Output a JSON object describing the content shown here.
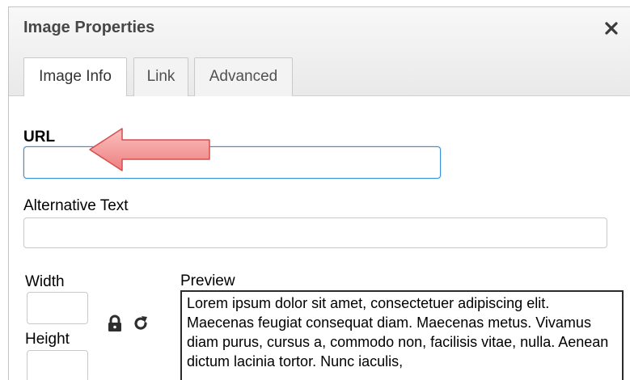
{
  "dialog": {
    "title": "Image Properties",
    "close_icon": "close-icon"
  },
  "tabs": [
    {
      "label": "Image Info",
      "active": true
    },
    {
      "label": "Link",
      "active": false
    },
    {
      "label": "Advanced",
      "active": false
    }
  ],
  "form": {
    "url": {
      "label": "URL",
      "value": ""
    },
    "alt_text": {
      "label": "Alternative Text",
      "value": ""
    },
    "width": {
      "label": "Width",
      "value": ""
    },
    "height": {
      "label": "Height",
      "value": ""
    },
    "lock_icon": "lock-icon",
    "reset_icon": "reset-size-icon"
  },
  "preview": {
    "label": "Preview",
    "text": "Lorem ipsum dolor sit amet, consectetuer adipiscing elit. Maecenas feugiat consequat diam. Maecenas metus. Vivamus diam purus, cursus a, commodo non, facilisis vitae, nulla. Aenean dictum lacinia tortor. Nunc iaculis,"
  },
  "annotation": {
    "arrow_icon": "pointing-arrow",
    "color": "#f28b8b"
  },
  "colors": {
    "focus_border": "#3e8bd8",
    "titlebar_text": "#474747"
  }
}
